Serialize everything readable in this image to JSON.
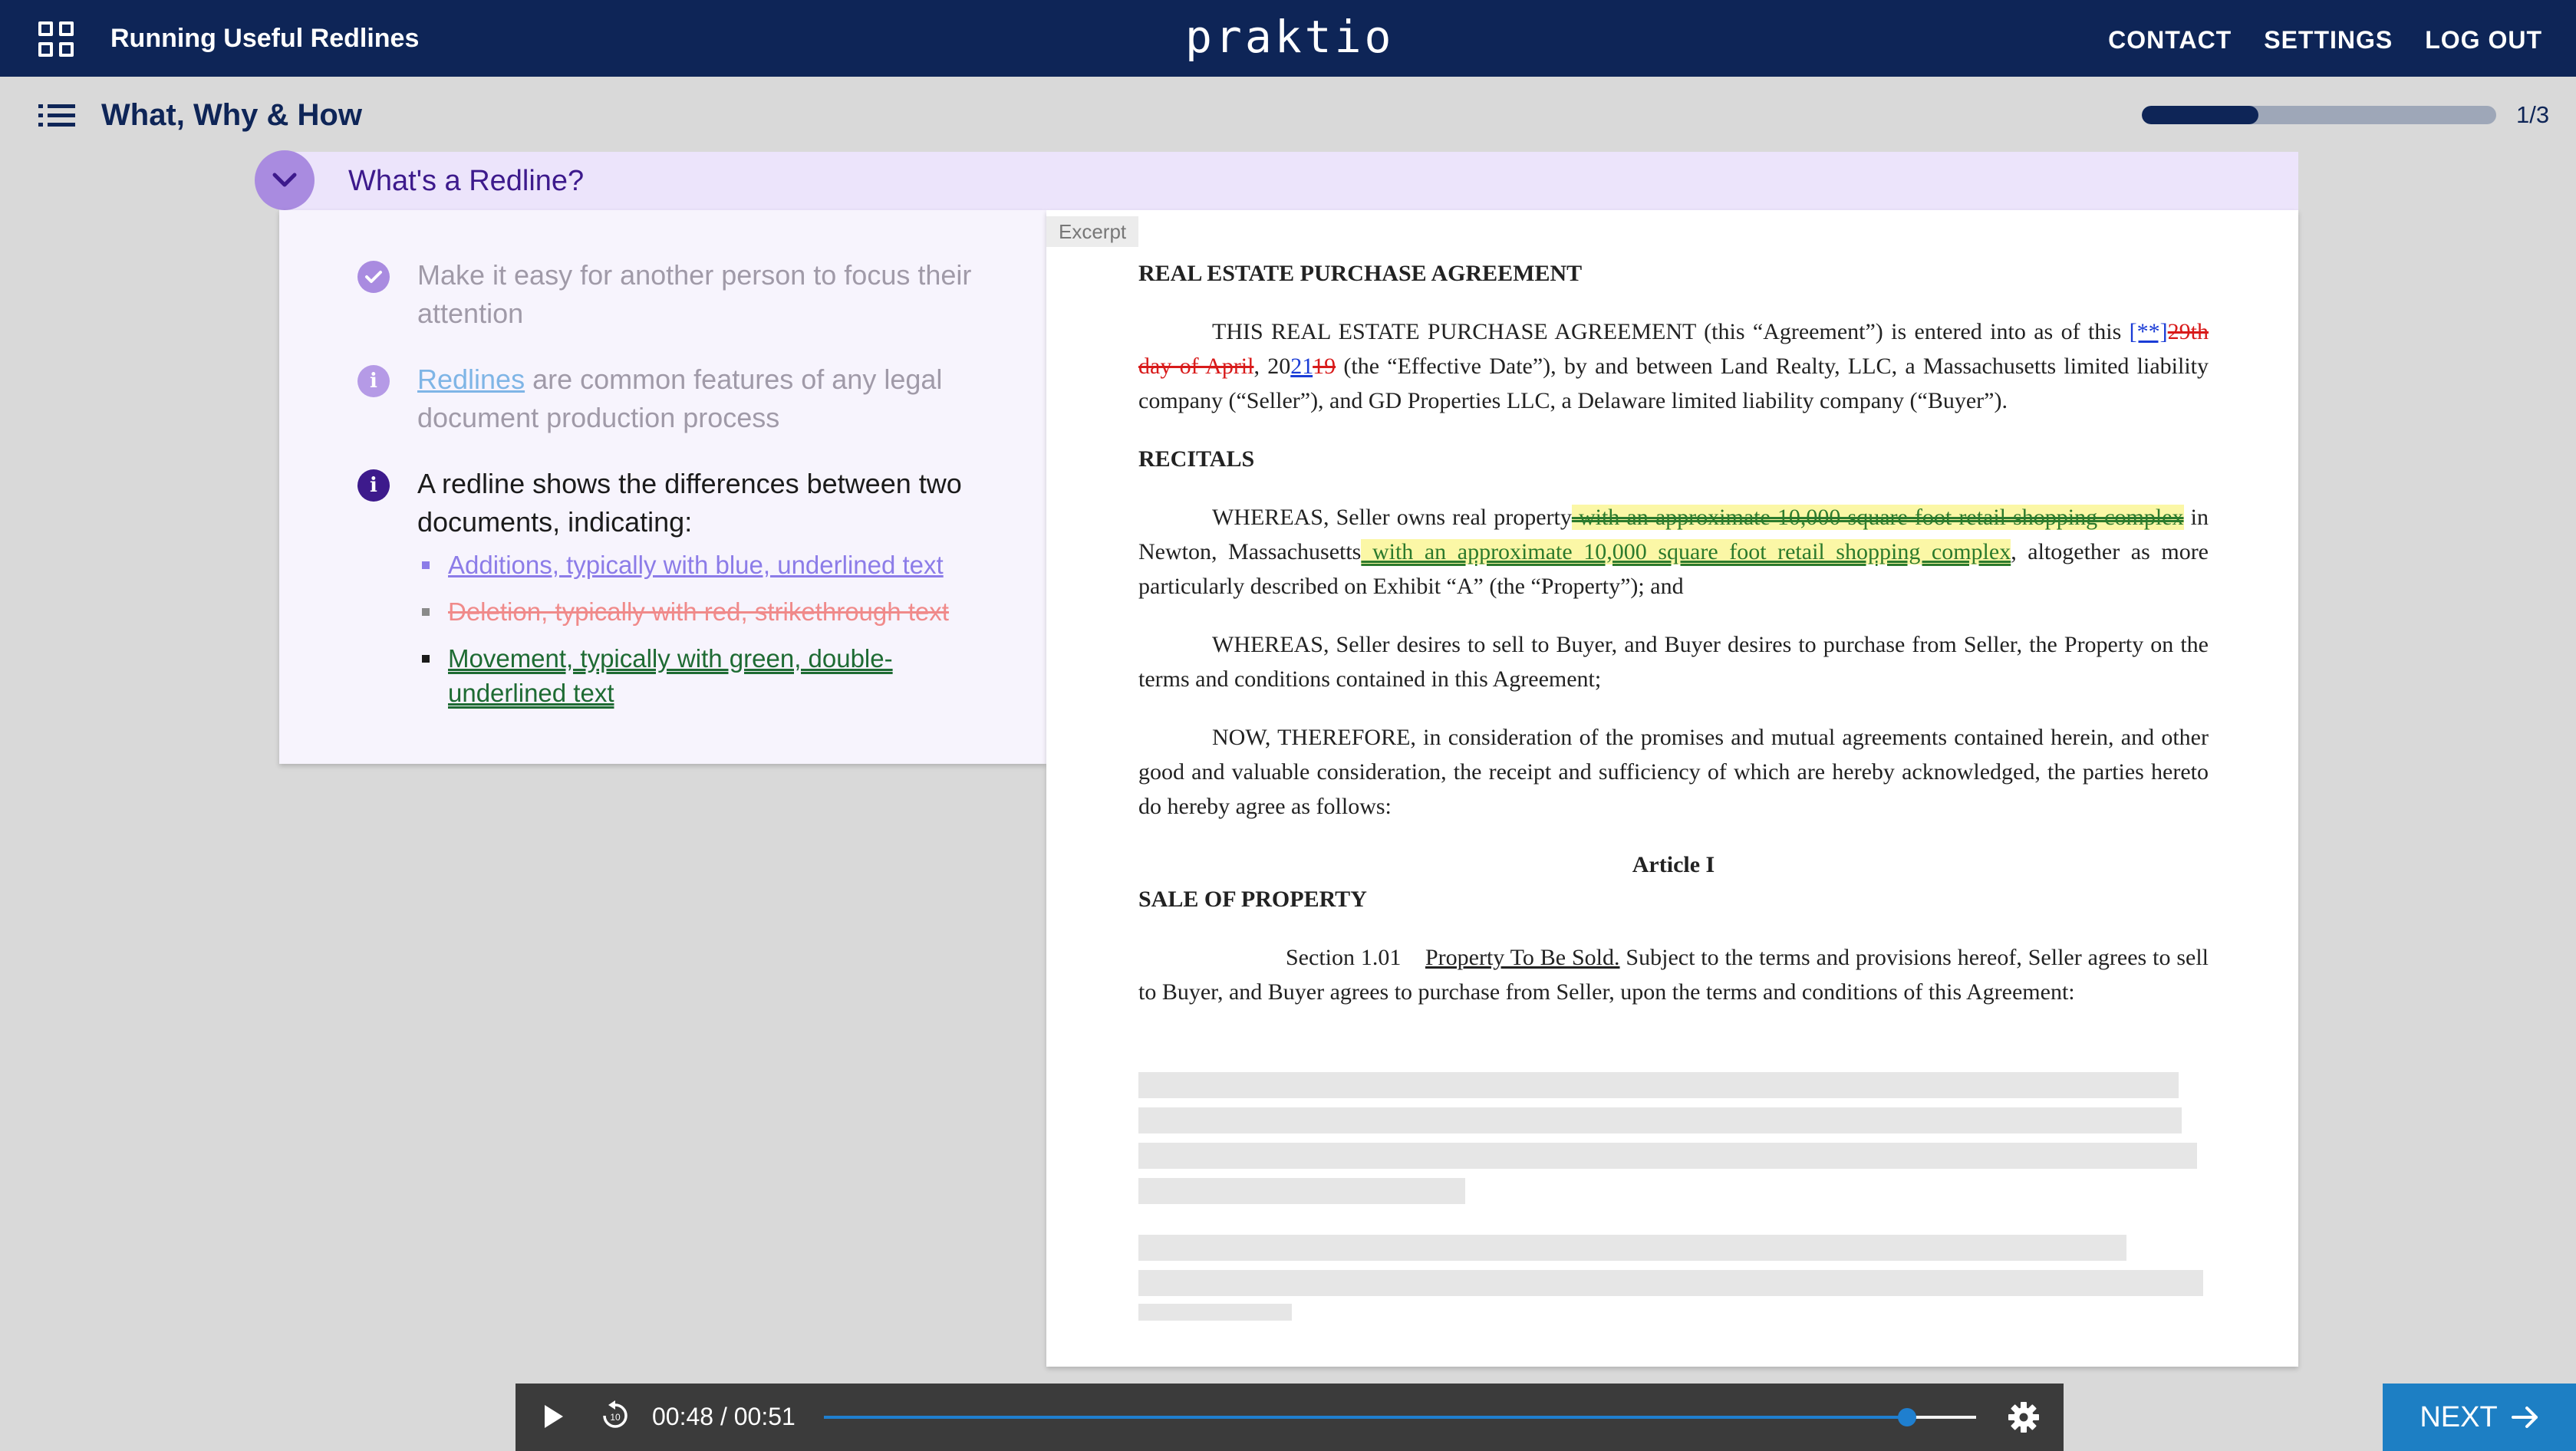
{
  "topbar": {
    "course_title": "Running Useful Redlines",
    "brand": "praktio",
    "nav": [
      "CONTACT",
      "SETTINGS",
      "LOG OUT"
    ]
  },
  "section": {
    "title": "What, Why & How",
    "progress_label": "1/3",
    "progress_fraction": 0.33
  },
  "card": {
    "title": "What's a Redline?",
    "points": [
      {
        "icon": "check-circle-icon",
        "text": "Make it easy for another person to focus their attention"
      },
      {
        "icon": "info-circle-icon",
        "link": "Redlines",
        "text": " are common features of any legal document production process"
      },
      {
        "icon": "info-circle-icon",
        "text": "A redline shows the differences between two documents, indicating:"
      }
    ],
    "bullets": [
      {
        "text": "Additions, typically with blue, underlined text",
        "color": "#8c7ce8"
      },
      {
        "text": "Deletion, typically with red, strikethrough text",
        "color": "#f08a8a"
      },
      {
        "text": "Movement, typically with green, double-underlined text",
        "color": "#1e6b33"
      }
    ]
  },
  "document": {
    "excerpt_label": "Excerpt",
    "title": "REAL ESTATE PURCHASE AGREEMENT",
    "p1": {
      "start": "THIS REAL ESTATE PURCHASE AGREEMENT (this “Agreement”) is entered into as of this ",
      "ins1": "[**]",
      "del1": "29th day of April",
      "mid": ", 20",
      "ins2": "21",
      "del2": "19",
      "end": " (the “Effective Date”), by and between Land Realty, LLC, a Massachusetts limited liability company (“Seller”), and GD Properties LLC, a Delaware limited liability company (“Buyer”)."
    },
    "recitals": "RECITALS",
    "p2": {
      "start": "WHEREAS, Seller owns real property",
      "moved_from": " with an approximate 10,000 square foot retail shopping complex",
      "mid": " in Newton, Massachusetts",
      "moved_to": " with an approximate 10,000 square foot retail shopping complex",
      "end": ", altogether as more particularly described on Exhibit “A” (the “Property”); and"
    },
    "p3": "WHEREAS, Seller desires to sell to Buyer, and Buyer desires to purchase from Seller, the Property on the terms and conditions contained in this Agreement;",
    "p4": "NOW, THEREFORE, in consideration of the promises and mutual agreements contained herein, and other good and valuable consideration, the receipt and sufficiency of which are hereby acknowledged, the parties hereto do hereby agree as follows:",
    "article": "Article I",
    "article_title": "SALE OF PROPERTY",
    "section_num": "Section 1.01",
    "section_heading": "Property To Be Sold.",
    "section_text": " Subject to the terms and provisions hereof, Seller agrees to sell to Buyer, and Buyer agrees to purchase from Seller, upon the terms and conditions of this Agreement:"
  },
  "video": {
    "time": "00:48 / 00:51",
    "progress_fraction": 0.94
  },
  "next_label": "NEXT"
}
